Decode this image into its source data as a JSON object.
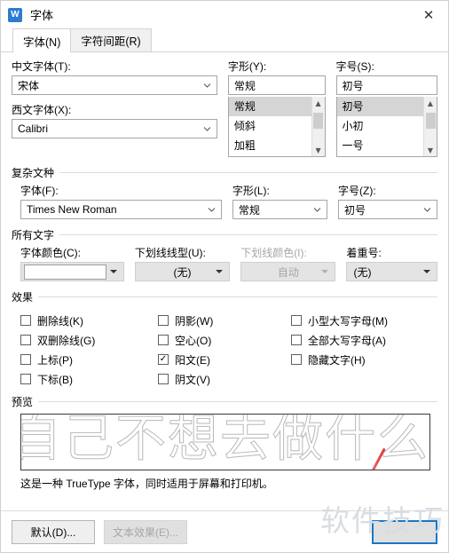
{
  "window": {
    "icon": "wps-writer-icon",
    "icon_glyph": "W",
    "title": "字体",
    "close_label": "✕"
  },
  "tabs": [
    {
      "label": "字体(N)",
      "active": true
    },
    {
      "label": "字符间距(R)",
      "active": false
    }
  ],
  "latin_section": {
    "cn_font_label": "中文字体(T):",
    "cn_font_value": "宋体",
    "western_font_label": "西文字体(X):",
    "western_font_value": "Calibri",
    "style_label": "字形(Y):",
    "style_value": "常规",
    "style_options": [
      "常规",
      "倾斜",
      "加粗"
    ],
    "style_selected_index": 0,
    "size_label": "字号(S):",
    "size_value": "初号",
    "size_options": [
      "初号",
      "小初",
      "一号"
    ],
    "size_selected_index": 0
  },
  "complex_script": {
    "group_title": "复杂文种",
    "font_label": "字体(F):",
    "font_value": "Times New Roman",
    "style_label": "字形(L):",
    "style_value": "常规",
    "size_label": "字号(Z):",
    "size_value": "初号"
  },
  "all_text": {
    "group_title": "所有文字",
    "color_label": "字体颜色(C):",
    "color_value": "#ffffff",
    "underline_style_label": "下划线线型(U):",
    "underline_style_value": "(无)",
    "underline_color_label": "下划线颜色(I):",
    "underline_color_value": "自动",
    "underline_color_disabled": true,
    "emphasis_label": "着重号:",
    "emphasis_value": "(无)"
  },
  "effects": {
    "group_title": "效果",
    "column1": [
      {
        "label": "删除线(K)",
        "checked": false
      },
      {
        "label": "双删除线(G)",
        "checked": false
      },
      {
        "label": "上标(P)",
        "checked": false
      },
      {
        "label": "下标(B)",
        "checked": false
      }
    ],
    "column2": [
      {
        "label": "阴影(W)",
        "checked": false
      },
      {
        "label": "空心(O)",
        "checked": false
      },
      {
        "label": "阳文(E)",
        "checked": true
      },
      {
        "label": "阴文(V)",
        "checked": false
      }
    ],
    "column3": [
      {
        "label": "小型大写字母(M)",
        "checked": false
      },
      {
        "label": "全部大写字母(A)",
        "checked": false
      },
      {
        "label": "隐藏文字(H)",
        "checked": false
      }
    ],
    "check_glyph": "✓"
  },
  "preview": {
    "group_title": "预览",
    "sample_text": "自己不想去做什么",
    "note": "这是一种 TrueType 字体，同时适用于屏幕和打印机。"
  },
  "footer": {
    "default_button": "默认(D)...",
    "text_effects_button": "文本效果(E)...",
    "text_effects_disabled": true,
    "confirm_button": ""
  },
  "watermark": {
    "text": "软件技巧"
  }
}
